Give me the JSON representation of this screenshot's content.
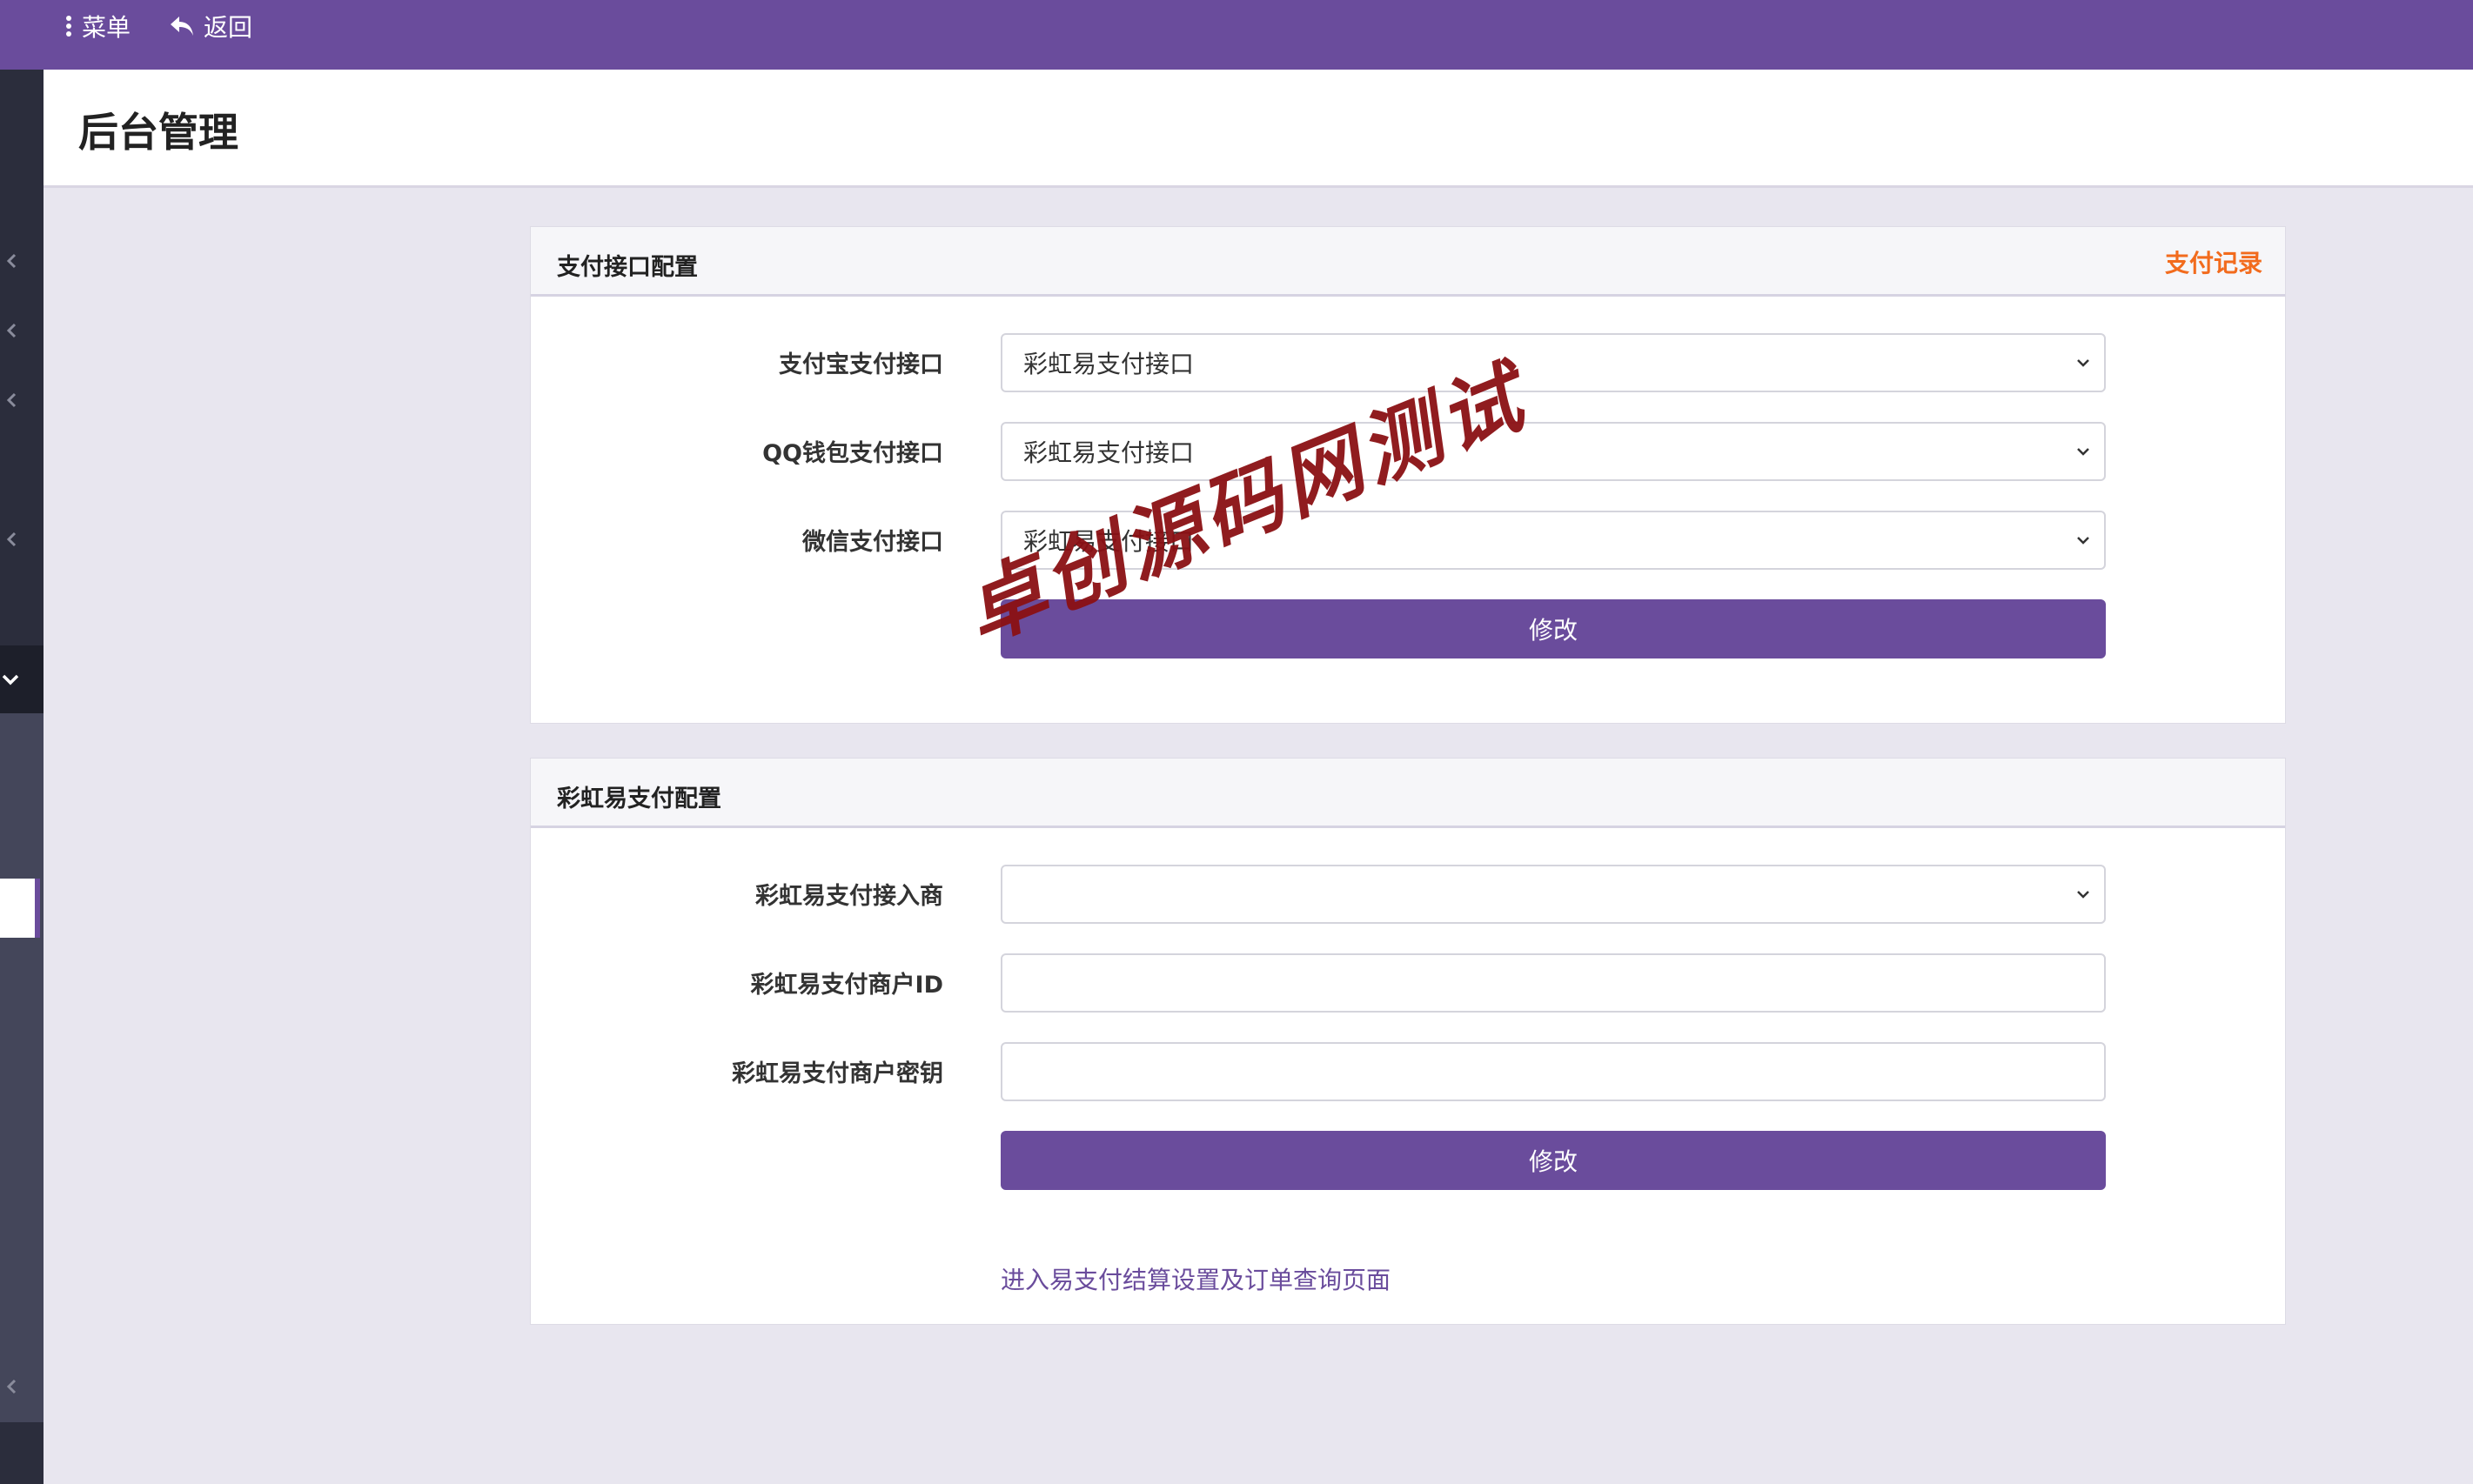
{
  "topbar": {
    "menu_label": "菜单",
    "back_label": "返回",
    "background": "#6a4c9c"
  },
  "header": {
    "title": "后台管理"
  },
  "pay_config": {
    "title": "支付接口配置",
    "records_link": "支付记录",
    "fields": [
      {
        "label": "支付宝支付接口",
        "value": "彩虹易支付接口"
      },
      {
        "label": "QQ钱包支付接口",
        "value": "彩虹易支付接口"
      },
      {
        "label": "微信支付接口",
        "value": "彩虹易支付接口"
      }
    ],
    "submit_label": "修改"
  },
  "epay_config": {
    "title": "彩虹易支付配置",
    "fields": [
      {
        "label": "彩虹易支付接入商",
        "value": ""
      },
      {
        "label": "彩虹易支付商户ID",
        "value": ""
      },
      {
        "label": "彩虹易支付商户密钥",
        "value": ""
      }
    ],
    "submit_label": "修改",
    "bottom_link": "进入易支付结算设置及订单查询页面"
  },
  "watermark": "卓创源码网测试",
  "colors": {
    "accent": "#6a4c9c",
    "link_orange": "#f26b1d",
    "watermark": "#8b1014"
  }
}
